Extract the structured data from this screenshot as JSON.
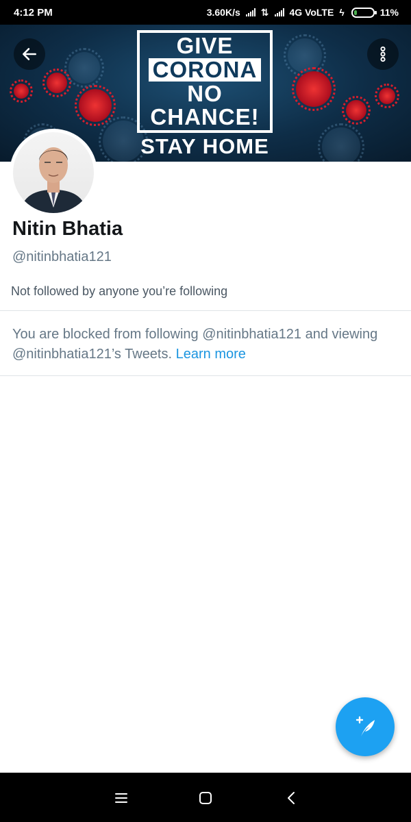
{
  "status_bar": {
    "time": "4:12 PM",
    "network_speed": "3.60K/s",
    "network_type": "4G VoLTE",
    "battery": "11%",
    "battery_level": 0.11
  },
  "banner": {
    "line1": "GIVE",
    "line2": "CORONA",
    "line3": "NO",
    "line4": "CHANCE!",
    "subline": "STAY HOME"
  },
  "profile": {
    "name": "Nitin Bhatia",
    "handle": "@nitinbhatia121",
    "followers_note": "Not followed by anyone you’re following"
  },
  "blocked": {
    "message": "You are blocked from following @nitinbhatia121 and viewing @nitinbhatia121’s Tweets.",
    "link_label": "Learn more"
  },
  "icons": {
    "back": "arrow-left-icon",
    "more": "more-vertical-icon",
    "compose": "compose-tweet-icon",
    "nav_menu": "menu-icon",
    "nav_home": "home-square-icon",
    "nav_back": "chevron-left-icon"
  },
  "colors": {
    "accent": "#1da1f2",
    "link": "#1b95e0",
    "secondary_text": "#657786"
  }
}
